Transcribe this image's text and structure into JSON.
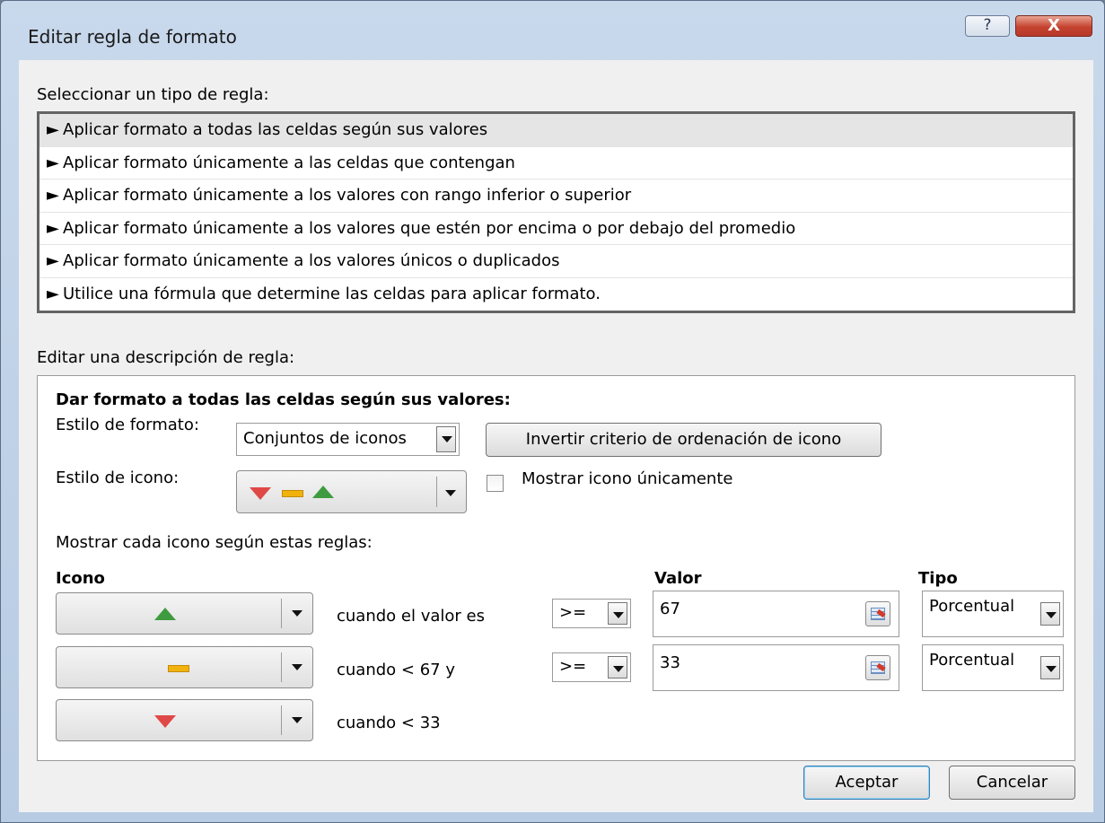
{
  "window": {
    "title": "Editar regla de formato",
    "help_label": "?",
    "close_label": "X"
  },
  "rule_type": {
    "label": "Seleccionar un tipo de regla:",
    "items": [
      "Aplicar formato a todas las celdas según sus valores",
      "Aplicar formato únicamente a las celdas que contengan",
      "Aplicar formato únicamente a los valores con rango inferior o superior",
      "Aplicar formato únicamente a los valores que estén por encima o por debajo del promedio",
      "Aplicar formato únicamente a los valores únicos o duplicados",
      "Utilice una fórmula que determine las celdas para aplicar formato."
    ],
    "selected_index": 0
  },
  "description": {
    "label": "Editar una descripción de regla:",
    "heading": "Dar formato a todas las celdas según sus valores:",
    "format_style_label": "Estilo de formato:",
    "format_style_value": "Conjuntos de iconos",
    "reverse_button": "Invertir criterio de ordenación de icono",
    "icon_style_label": "Estilo de icono:",
    "show_icon_only_label": "Mostrar icono únicamente",
    "show_icon_only_checked": false,
    "rules_heading": "Mostrar cada icono según estas reglas:",
    "col_icon": "Icono",
    "col_value": "Valor",
    "col_type": "Tipo",
    "rows": [
      {
        "icon": "green-up-triangle-icon",
        "condition": "cuando el valor es",
        "operator": ">=",
        "value": "67",
        "type": "Porcentual"
      },
      {
        "icon": "yellow-dash-icon",
        "condition": "cuando < 67 y",
        "operator": ">=",
        "value": "33",
        "type": "Porcentual"
      },
      {
        "icon": "red-down-triangle-icon",
        "condition": "cuando < 33"
      }
    ]
  },
  "footer": {
    "ok": "Aceptar",
    "cancel": "Cancelar"
  },
  "colors": {
    "up": "#3f9b3f",
    "mid": "#f2b20d",
    "down": "#e04848"
  }
}
